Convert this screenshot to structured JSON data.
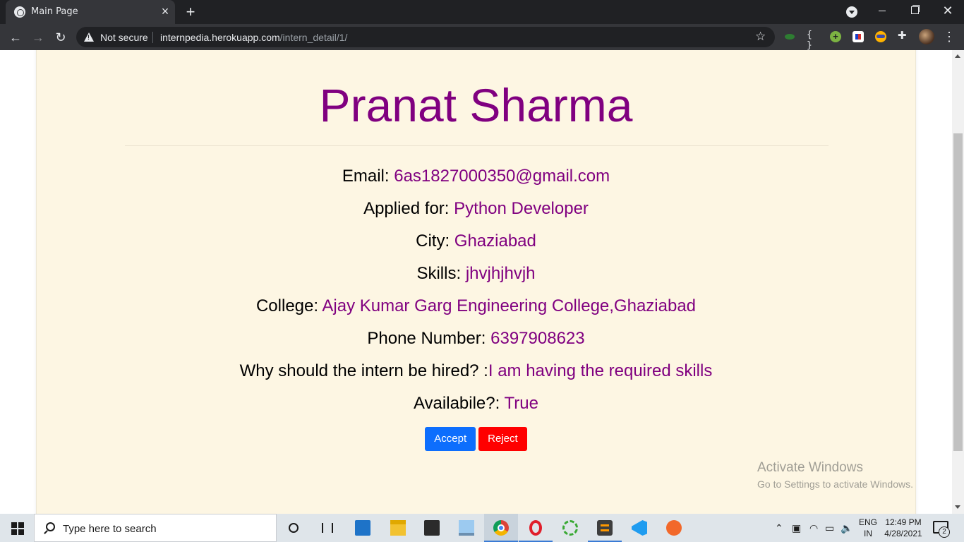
{
  "browser": {
    "tab_title": "Main Page",
    "security_label": "Not secure",
    "url_host": "internpedia.herokuapp.com",
    "url_path": "/intern_detail/1/"
  },
  "intern": {
    "name": "Pranat Sharma",
    "fields": [
      {
        "label": "Email: ",
        "value": "6as1827000350@gmail.com"
      },
      {
        "label": "Applied for: ",
        "value": "Python Developer"
      },
      {
        "label": "City: ",
        "value": "Ghaziabad"
      },
      {
        "label": "Skills: ",
        "value": "jhvjhjhvjh"
      },
      {
        "label": "College: ",
        "value": "Ajay Kumar Garg Engineering College,Ghaziabad"
      },
      {
        "label": "Phone Number: ",
        "value": "6397908623"
      },
      {
        "label": "Why should the intern be hired? :",
        "value": "I am having the required skills"
      },
      {
        "label": "Availabile?: ",
        "value": "True"
      }
    ],
    "accept_label": "Accept",
    "reject_label": "Reject"
  },
  "watermark": {
    "title": "Activate Windows",
    "subtitle": "Go to Settings to activate Windows."
  },
  "taskbar": {
    "search_placeholder": "Type here to search",
    "lang_line1": "ENG",
    "lang_line2": "IN",
    "time": "12:49 PM",
    "date": "4/28/2021",
    "notification_count": "2"
  },
  "colors": {
    "page_background": "#fdf6e3",
    "value_text": "#800080",
    "accept": "#0d6efd",
    "reject": "#ff0000"
  }
}
